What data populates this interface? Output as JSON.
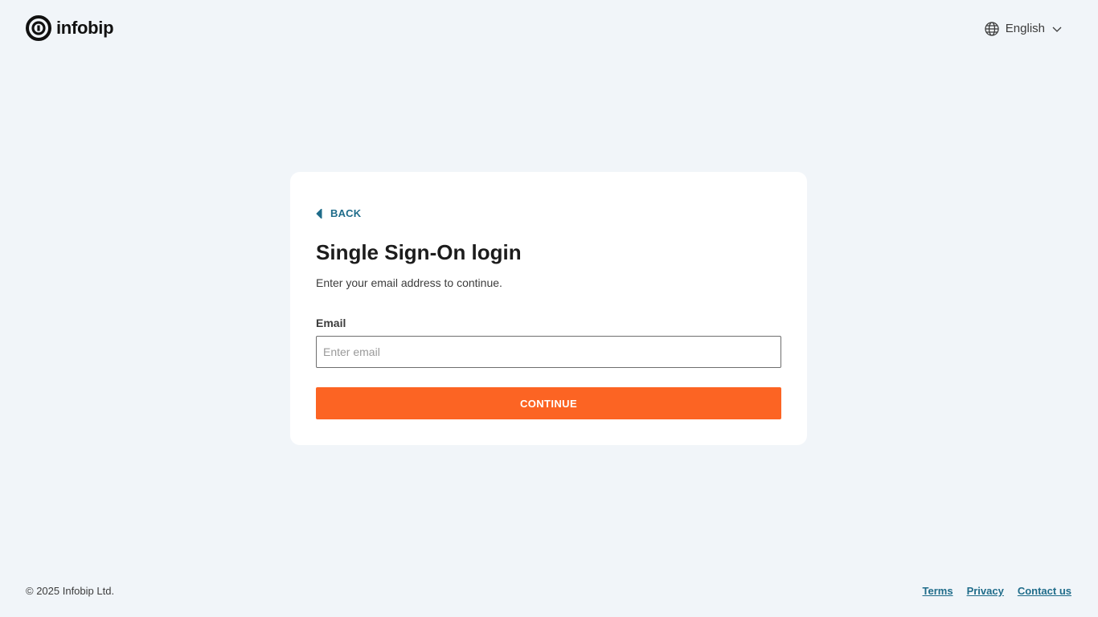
{
  "header": {
    "logo_text": "infobip",
    "language": {
      "label": "English",
      "icon": "globe-icon",
      "chevron_icon": "chevron-down-icon"
    }
  },
  "card": {
    "back": {
      "label": "BACK",
      "icon": "caret-left-icon"
    },
    "title": "Single Sign-On login",
    "subtitle": "Enter your email address to continue.",
    "email": {
      "label": "Email",
      "placeholder": "Enter email",
      "value": ""
    },
    "continue_label": "CONTINUE"
  },
  "footer": {
    "copyright": "© 2025 Infobip Ltd.",
    "links": [
      {
        "label": "Terms"
      },
      {
        "label": "Privacy"
      },
      {
        "label": "Contact us"
      }
    ]
  },
  "colors": {
    "background": "#f1f5f9",
    "card": "#ffffff",
    "accent": "#fc6423",
    "link": "#1f6c8a"
  }
}
